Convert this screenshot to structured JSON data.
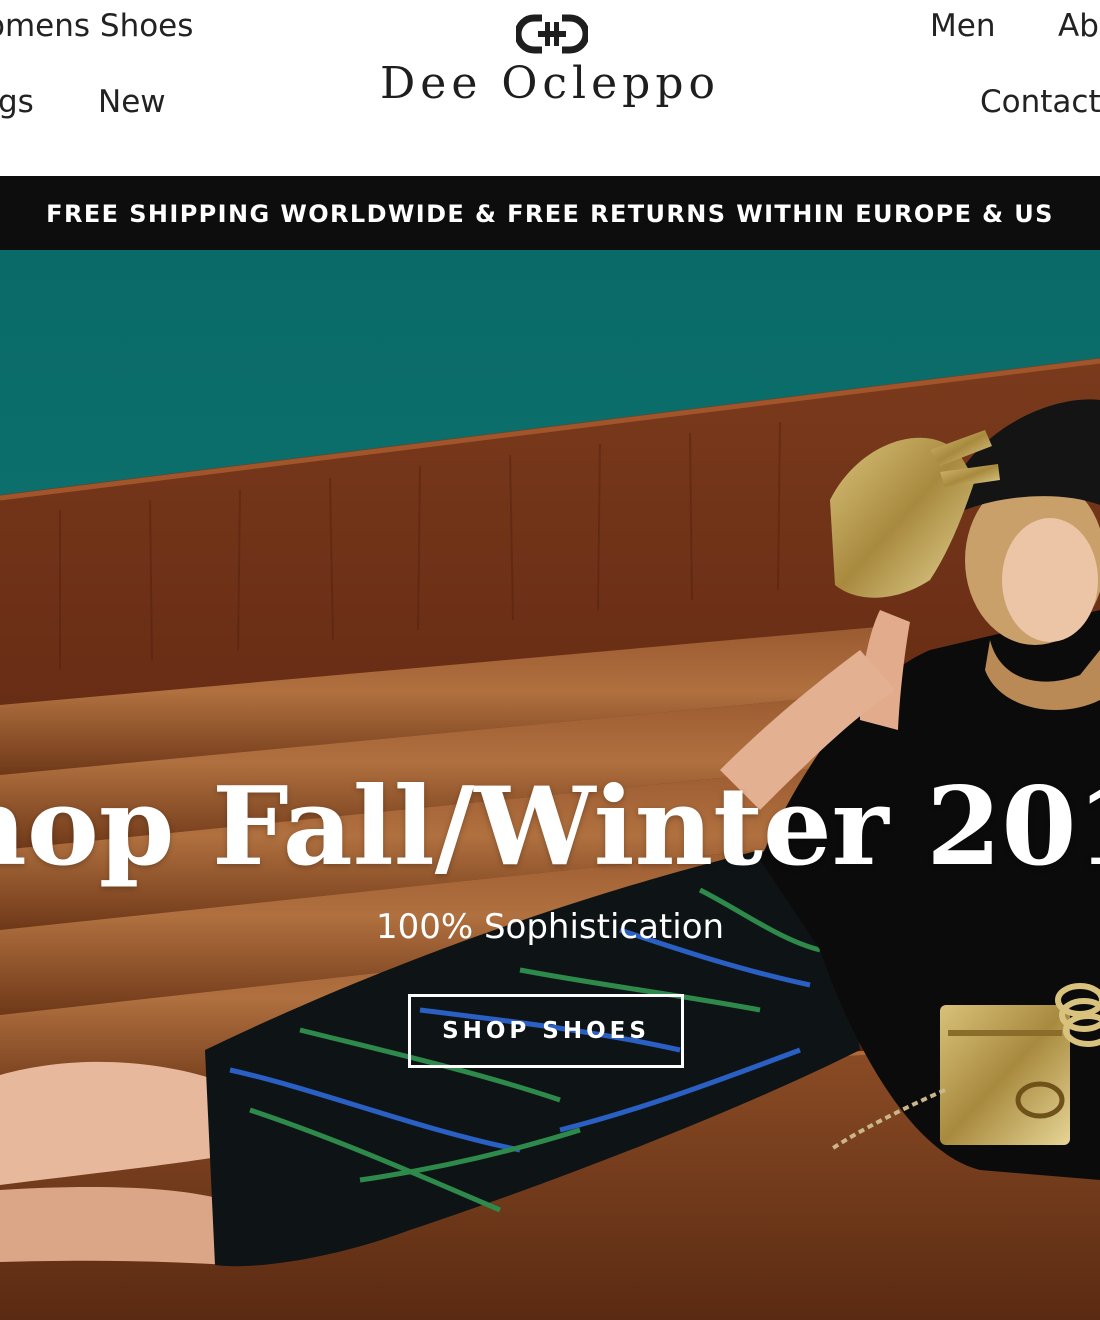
{
  "header": {
    "brand": "Dee Ocleppo",
    "nav_left": [
      {
        "label": "omens Shoes"
      },
      {
        "label": "gs"
      },
      {
        "label": "New"
      }
    ],
    "nav_right": [
      {
        "label": "Men"
      },
      {
        "label": "Ab"
      },
      {
        "label": "Contact"
      }
    ]
  },
  "promo_bar": {
    "text": "FREE SHIPPING WORLDWIDE & FREE RETURNS WITHIN EUROPE & US"
  },
  "hero": {
    "title": "hop Fall/Winter 201",
    "subtitle": "100% Sophistication",
    "cta_label": "SHOP SHOES"
  },
  "icons": {
    "logo": "brand-monogram-icon"
  },
  "colors": {
    "promo_bg": "#0d0d0d",
    "hero_wall": "#0f7774",
    "hero_wood": "#6b2e16",
    "hero_leather": "#8a4a24",
    "text_dark": "#222222",
    "white": "#ffffff"
  }
}
